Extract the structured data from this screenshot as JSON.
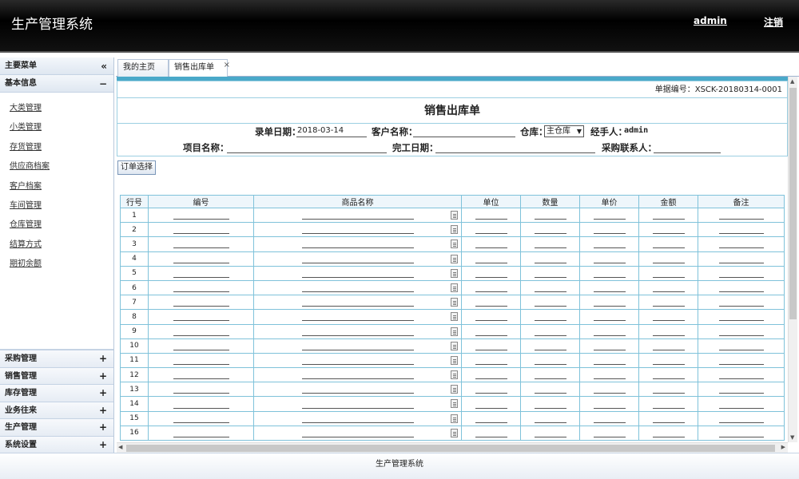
{
  "header": {
    "app_title": "生产管理系统",
    "user": "admin",
    "logout": "注销"
  },
  "sidebar": {
    "main_menu": "主要菜单",
    "main_menu_sign": "«",
    "basic_info": "基本信息",
    "basic_info_sign": "−",
    "items": [
      "大类管理",
      "小类管理",
      "存货管理",
      "供应商档案",
      "客户档案",
      "车间管理",
      "仓库管理",
      "结算方式",
      "期初余额"
    ],
    "groups": [
      "采购管理",
      "销售管理",
      "库存管理",
      "业务往来",
      "生产管理",
      "系统设置"
    ],
    "group_sign": "+"
  },
  "tabs": [
    {
      "label": "我的主页"
    },
    {
      "label": "销售出库单",
      "close": "×"
    }
  ],
  "form": {
    "doc_no_label": "单据编号：",
    "doc_no": "XSCK-20180314-0001",
    "title": "销售出库单",
    "entry_date_label": "录单日期：",
    "entry_date": "2018-03-14",
    "customer_label": "客户名称：",
    "warehouse_label": "仓库：",
    "warehouse": "主仓库",
    "handler_label": "经手人：",
    "handler": "admin",
    "project_label": "项目名称：",
    "finish_date_label": "完工日期：",
    "purchase_contact_label": "采购联系人：",
    "order_select": "订单选择"
  },
  "grid": {
    "columns": [
      "行号",
      "编号",
      "商品名称",
      "单位",
      "数量",
      "单价",
      "金额",
      "备注"
    ],
    "rows": [
      "1",
      "2",
      "3",
      "4",
      "5",
      "6",
      "7",
      "8",
      "9",
      "10",
      "11",
      "12",
      "13",
      "14",
      "15",
      "16"
    ]
  },
  "footer": {
    "text": "生产管理系统"
  },
  "colors": {
    "header_bg": "#000000",
    "accent": "#4aa9c9",
    "grid_border": "#7fc2da"
  }
}
